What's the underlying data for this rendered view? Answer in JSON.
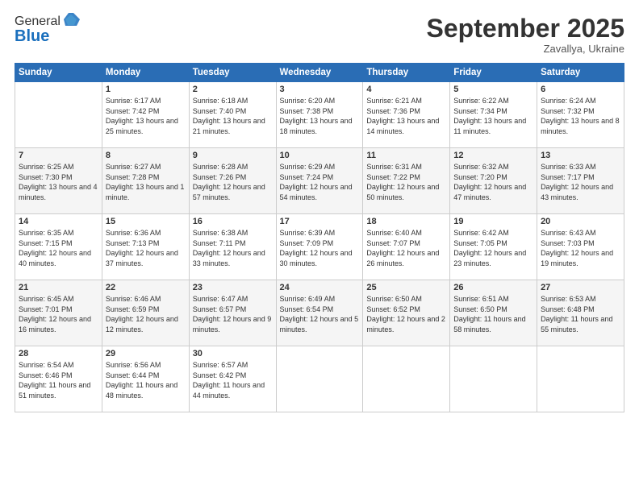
{
  "logo": {
    "general": "General",
    "blue": "Blue"
  },
  "header": {
    "month": "September 2025",
    "location": "Zavallya, Ukraine"
  },
  "weekdays": [
    "Sunday",
    "Monday",
    "Tuesday",
    "Wednesday",
    "Thursday",
    "Friday",
    "Saturday"
  ],
  "weeks": [
    [
      {
        "day": "",
        "sunrise": "",
        "sunset": "",
        "daylight": ""
      },
      {
        "day": "1",
        "sunrise": "Sunrise: 6:17 AM",
        "sunset": "Sunset: 7:42 PM",
        "daylight": "Daylight: 13 hours and 25 minutes."
      },
      {
        "day": "2",
        "sunrise": "Sunrise: 6:18 AM",
        "sunset": "Sunset: 7:40 PM",
        "daylight": "Daylight: 13 hours and 21 minutes."
      },
      {
        "day": "3",
        "sunrise": "Sunrise: 6:20 AM",
        "sunset": "Sunset: 7:38 PM",
        "daylight": "Daylight: 13 hours and 18 minutes."
      },
      {
        "day": "4",
        "sunrise": "Sunrise: 6:21 AM",
        "sunset": "Sunset: 7:36 PM",
        "daylight": "Daylight: 13 hours and 14 minutes."
      },
      {
        "day": "5",
        "sunrise": "Sunrise: 6:22 AM",
        "sunset": "Sunset: 7:34 PM",
        "daylight": "Daylight: 13 hours and 11 minutes."
      },
      {
        "day": "6",
        "sunrise": "Sunrise: 6:24 AM",
        "sunset": "Sunset: 7:32 PM",
        "daylight": "Daylight: 13 hours and 8 minutes."
      }
    ],
    [
      {
        "day": "7",
        "sunrise": "Sunrise: 6:25 AM",
        "sunset": "Sunset: 7:30 PM",
        "daylight": "Daylight: 13 hours and 4 minutes."
      },
      {
        "day": "8",
        "sunrise": "Sunrise: 6:27 AM",
        "sunset": "Sunset: 7:28 PM",
        "daylight": "Daylight: 13 hours and 1 minute."
      },
      {
        "day": "9",
        "sunrise": "Sunrise: 6:28 AM",
        "sunset": "Sunset: 7:26 PM",
        "daylight": "Daylight: 12 hours and 57 minutes."
      },
      {
        "day": "10",
        "sunrise": "Sunrise: 6:29 AM",
        "sunset": "Sunset: 7:24 PM",
        "daylight": "Daylight: 12 hours and 54 minutes."
      },
      {
        "day": "11",
        "sunrise": "Sunrise: 6:31 AM",
        "sunset": "Sunset: 7:22 PM",
        "daylight": "Daylight: 12 hours and 50 minutes."
      },
      {
        "day": "12",
        "sunrise": "Sunrise: 6:32 AM",
        "sunset": "Sunset: 7:20 PM",
        "daylight": "Daylight: 12 hours and 47 minutes."
      },
      {
        "day": "13",
        "sunrise": "Sunrise: 6:33 AM",
        "sunset": "Sunset: 7:17 PM",
        "daylight": "Daylight: 12 hours and 43 minutes."
      }
    ],
    [
      {
        "day": "14",
        "sunrise": "Sunrise: 6:35 AM",
        "sunset": "Sunset: 7:15 PM",
        "daylight": "Daylight: 12 hours and 40 minutes."
      },
      {
        "day": "15",
        "sunrise": "Sunrise: 6:36 AM",
        "sunset": "Sunset: 7:13 PM",
        "daylight": "Daylight: 12 hours and 37 minutes."
      },
      {
        "day": "16",
        "sunrise": "Sunrise: 6:38 AM",
        "sunset": "Sunset: 7:11 PM",
        "daylight": "Daylight: 12 hours and 33 minutes."
      },
      {
        "day": "17",
        "sunrise": "Sunrise: 6:39 AM",
        "sunset": "Sunset: 7:09 PM",
        "daylight": "Daylight: 12 hours and 30 minutes."
      },
      {
        "day": "18",
        "sunrise": "Sunrise: 6:40 AM",
        "sunset": "Sunset: 7:07 PM",
        "daylight": "Daylight: 12 hours and 26 minutes."
      },
      {
        "day": "19",
        "sunrise": "Sunrise: 6:42 AM",
        "sunset": "Sunset: 7:05 PM",
        "daylight": "Daylight: 12 hours and 23 minutes."
      },
      {
        "day": "20",
        "sunrise": "Sunrise: 6:43 AM",
        "sunset": "Sunset: 7:03 PM",
        "daylight": "Daylight: 12 hours and 19 minutes."
      }
    ],
    [
      {
        "day": "21",
        "sunrise": "Sunrise: 6:45 AM",
        "sunset": "Sunset: 7:01 PM",
        "daylight": "Daylight: 12 hours and 16 minutes."
      },
      {
        "day": "22",
        "sunrise": "Sunrise: 6:46 AM",
        "sunset": "Sunset: 6:59 PM",
        "daylight": "Daylight: 12 hours and 12 minutes."
      },
      {
        "day": "23",
        "sunrise": "Sunrise: 6:47 AM",
        "sunset": "Sunset: 6:57 PM",
        "daylight": "Daylight: 12 hours and 9 minutes."
      },
      {
        "day": "24",
        "sunrise": "Sunrise: 6:49 AM",
        "sunset": "Sunset: 6:54 PM",
        "daylight": "Daylight: 12 hours and 5 minutes."
      },
      {
        "day": "25",
        "sunrise": "Sunrise: 6:50 AM",
        "sunset": "Sunset: 6:52 PM",
        "daylight": "Daylight: 12 hours and 2 minutes."
      },
      {
        "day": "26",
        "sunrise": "Sunrise: 6:51 AM",
        "sunset": "Sunset: 6:50 PM",
        "daylight": "Daylight: 11 hours and 58 minutes."
      },
      {
        "day": "27",
        "sunrise": "Sunrise: 6:53 AM",
        "sunset": "Sunset: 6:48 PM",
        "daylight": "Daylight: 11 hours and 55 minutes."
      }
    ],
    [
      {
        "day": "28",
        "sunrise": "Sunrise: 6:54 AM",
        "sunset": "Sunset: 6:46 PM",
        "daylight": "Daylight: 11 hours and 51 minutes."
      },
      {
        "day": "29",
        "sunrise": "Sunrise: 6:56 AM",
        "sunset": "Sunset: 6:44 PM",
        "daylight": "Daylight: 11 hours and 48 minutes."
      },
      {
        "day": "30",
        "sunrise": "Sunrise: 6:57 AM",
        "sunset": "Sunset: 6:42 PM",
        "daylight": "Daylight: 11 hours and 44 minutes."
      },
      {
        "day": "",
        "sunrise": "",
        "sunset": "",
        "daylight": ""
      },
      {
        "day": "",
        "sunrise": "",
        "sunset": "",
        "daylight": ""
      },
      {
        "day": "",
        "sunrise": "",
        "sunset": "",
        "daylight": ""
      },
      {
        "day": "",
        "sunrise": "",
        "sunset": "",
        "daylight": ""
      }
    ]
  ]
}
